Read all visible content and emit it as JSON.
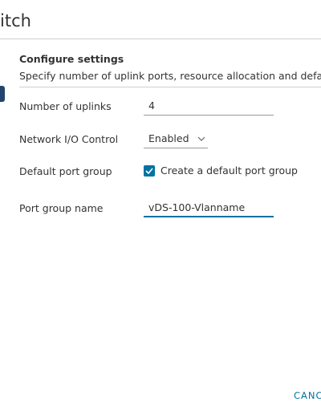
{
  "wizard": {
    "title": "itch"
  },
  "step": {
    "heading": "Configure settings",
    "description": "Specify number of uplink ports, resource allocation and default"
  },
  "form": {
    "uplinks": {
      "label": "Number of uplinks",
      "value": "4"
    },
    "nioc": {
      "label": "Network I/O Control",
      "selected": "Enabled"
    },
    "default_port_group": {
      "label": "Default port group",
      "checked": true,
      "checkbox_label": "Create a default port group"
    },
    "port_group_name": {
      "label": "Port group name",
      "value": "vDS-100-Vlanname"
    }
  },
  "footer": {
    "cancel_label": "CANC"
  },
  "colors": {
    "accent": "#0072a3",
    "step_indicator": "#22456e",
    "text": "#333333"
  }
}
